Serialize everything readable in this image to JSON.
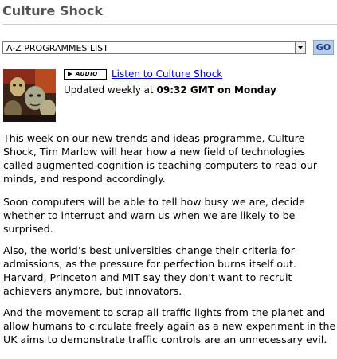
{
  "header": {
    "title": "Culture Shock"
  },
  "programmes": {
    "selected": "A-Z PROGRAMMES LIST",
    "go_label": "GO"
  },
  "audio": {
    "badge_label": "AUDIO",
    "listen_label": "Listen to Culture Shock",
    "updated_prefix": "Updated weekly at ",
    "updated_time": "09:32 GMT on Monday"
  },
  "content": {
    "paragraphs": [
      "This week on our new trends and ideas programme, Culture Shock, Tim Marlow will hear how a new field of technologies called augmented cognition is teaching computers to read our minds, and respond accordingly.",
      "Soon computers will be able to tell how busy we are, decide whether to interrupt and warn us when we are likely to be surprised.",
      "Also, the world’s best universities change their criteria for admissions, as the pressure for perfection burns itself out. Harvard, Princeton and MIT say they don't want to recruit achievers anymore, but innovators.",
      "And the movement to scrap all traffic lights from the planet and allow humans to circulate freely again as a new experiment in the UK aims to demonstrate traffic controls are an unnecessary evil."
    ]
  },
  "colors": {
    "title": "#555555",
    "link": "#0000cc",
    "go_button_bg": "#b8cde8"
  },
  "icons": {
    "dropdown": "chevron-down-icon",
    "audio": "play-icon"
  }
}
